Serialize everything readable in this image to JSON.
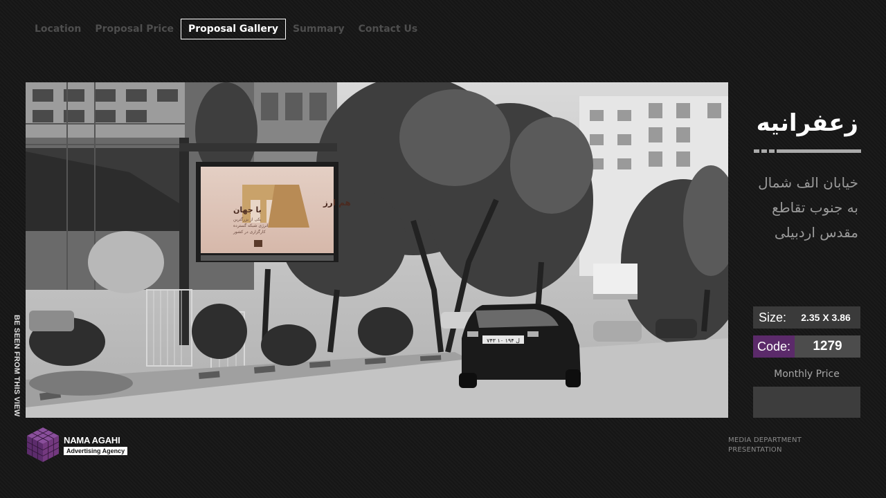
{
  "nav": {
    "items": [
      {
        "label": "Location",
        "active": false
      },
      {
        "label": "Proposal Price",
        "active": false
      },
      {
        "label": "Proposal Gallery",
        "active": true
      },
      {
        "label": "Summary",
        "active": false
      },
      {
        "label": "Contact Us",
        "active": false
      }
    ]
  },
  "photo": {
    "side_label": "BE SEEN FROM THIS VIEW",
    "billboard": {
      "headline": "هم ارز",
      "subline": "با جهان",
      "body_lines": [
        "یکی از بزرگترین",
        "انرژی شبکه گسترده",
        "کارگزاری در کشور"
      ]
    },
    "plate": "۷۴۳ ل ۱۹۴ ۱۰"
  },
  "location": {
    "title": "زعفرانیه",
    "address_lines": [
      "خیابان الف شمال",
      "به جنوب تقاطع",
      "مقدس اردبیلی"
    ]
  },
  "specs": {
    "size_label": "Size:",
    "size_value": "2.35 X 3.86",
    "code_label": "Code:",
    "code_value": "1279",
    "monthly_label": "Monthly Price",
    "monthly_value": ""
  },
  "brand": {
    "name": "NAMA AGAHI",
    "tagline": "Advertising Agency"
  },
  "footer": {
    "line1": "MEDIA DEPARTMENT",
    "line2": "PRESENTATION"
  },
  "colors": {
    "background": "#161616",
    "accent_purple": "#5b2a6a",
    "nav_inactive": "#4e4e4e",
    "nav_active": "#ffffff"
  }
}
